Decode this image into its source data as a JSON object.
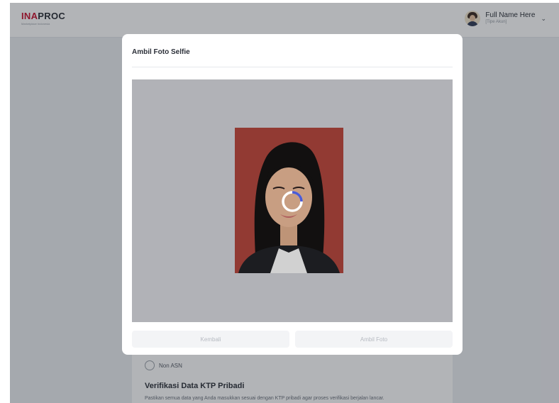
{
  "header": {
    "logo_prefix": "INA",
    "logo_rest": "PROC",
    "logo_tagline": "Marketplace Indonesia",
    "user_name": "Full Name Here",
    "user_role": "[Tipe Akun]"
  },
  "page": {
    "radio_label": "Non ASN",
    "section_title": "Verifikasi Data KTP Pribadi",
    "section_desc": "Pastikan semua data yang Anda masukkan sesuai dengan KTP pribadi agar proses verifikasi berjalan lancar."
  },
  "modal": {
    "title": "Ambil Foto Selfie",
    "back_label": "Kembali",
    "capture_label": "Ambil Foto"
  },
  "colors": {
    "brand": "#c8102e",
    "spinner_accent": "#4a5bd6",
    "photo_background": "#a7433b"
  },
  "icons": {
    "loading": "loading-spinner-icon",
    "user_menu": "chevron-down-icon"
  }
}
